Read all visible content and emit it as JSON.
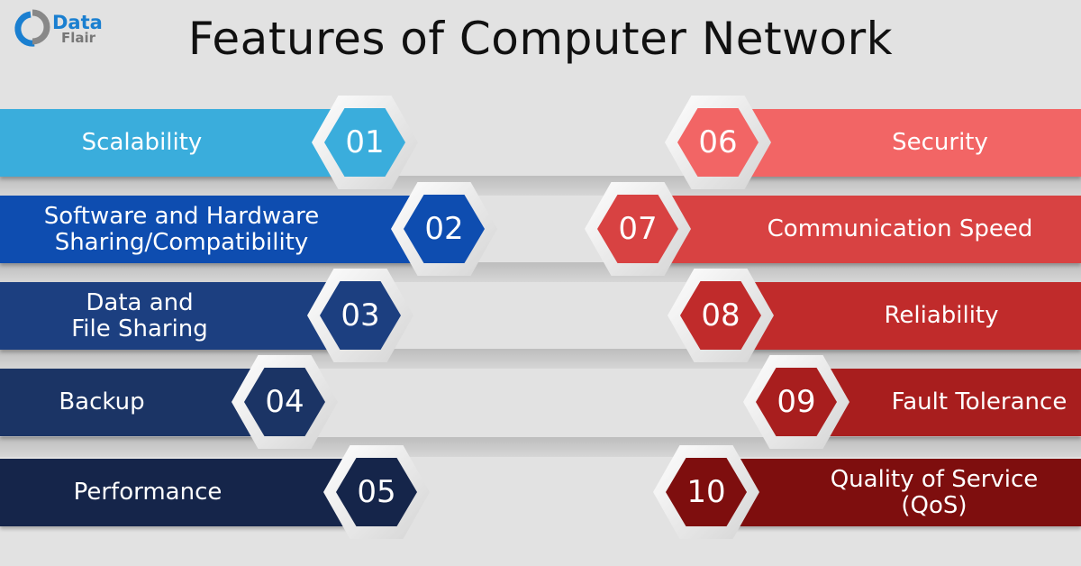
{
  "title": "Features of Computer Network",
  "logo": {
    "line1": "Data",
    "line2": "Flair"
  },
  "left": [
    {
      "num": "01",
      "label": "Scalability",
      "color": "#3aaddc"
    },
    {
      "num": "02",
      "label": "Software and Hardware\nSharing/Compatibility",
      "color": "#0e4db0"
    },
    {
      "num": "03",
      "label": "Data and\nFile Sharing",
      "color": "#1c3f80"
    },
    {
      "num": "04",
      "label": "Backup",
      "color": "#1b3465"
    },
    {
      "num": "05",
      "label": "Performance",
      "color": "#15254a"
    }
  ],
  "right": [
    {
      "num": "06",
      "label": "Security",
      "color": "#f26565"
    },
    {
      "num": "07",
      "label": "Communication Speed",
      "color": "#d84242"
    },
    {
      "num": "08",
      "label": "Reliability",
      "color": "#c02b2b"
    },
    {
      "num": "09",
      "label": "Fault Tolerance",
      "color": "#a81e1e"
    },
    {
      "num": "10",
      "label": "Quality of Service\n(QoS)",
      "color": "#7e0e0e"
    }
  ]
}
